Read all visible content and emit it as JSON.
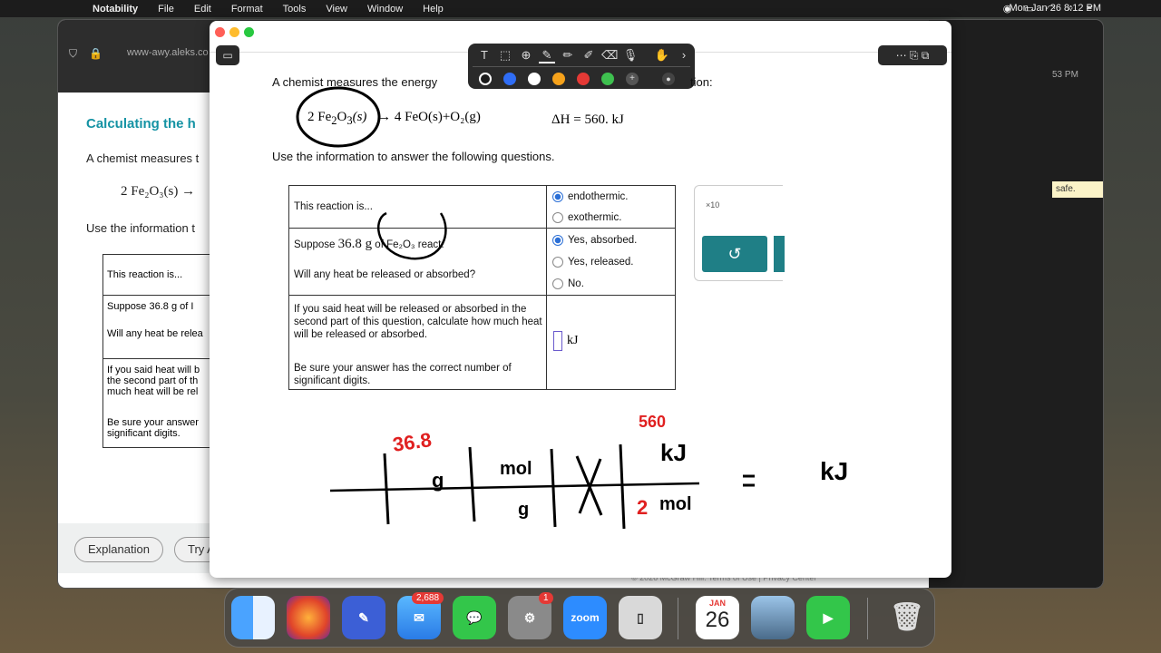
{
  "menubar": {
    "apple": "",
    "app": "Notability",
    "items": [
      "File",
      "Edit",
      "Format",
      "Tools",
      "View",
      "Window",
      "Help"
    ],
    "clock": "Mon Jan 26  8:12 PM"
  },
  "browser": {
    "url": "www-awy.aleks.co",
    "title": "Calculating the h",
    "intro": "A chemist measures t",
    "reaction": "2 Fe₂O₃(s) →",
    "use_info": "Use the information t",
    "rows": [
      "This reaction is...",
      "Suppose 36.8 g of I",
      "Will any heat be relea",
      "If you said heat will b",
      "the second part of th",
      "much heat will be rel",
      "Be sure your answer",
      "significant digits."
    ],
    "buttons": {
      "explanation": "Explanation",
      "try": "Try A"
    },
    "footer": "© 2026 McGraw Hill.   Terms of Use   |   Privacy Center",
    "side_time": "53 PM",
    "side_note": "safe."
  },
  "note": {
    "question": "A chemist measures the energy",
    "question_end": "tion:",
    "reaction_left": "2 Fe",
    "reaction_right": "→ 4 FeO(s)+O₂(g)",
    "reaction_sub": "2",
    "reaction_o": "O",
    "reaction_sub2": "3",
    "reaction_s": "(s)",
    "enthalpy": "ΔH = 560. kJ",
    "use_info": "Use the information to answer the following questions.",
    "table": {
      "r1_label": "This reaction is...",
      "r1_opt1": "endothermic.",
      "r1_opt2": "exothermic.",
      "r2_label_a": "Suppose ",
      "r2_mass": "36.8 g",
      "r2_label_b": " of Fe₂O₃ react.",
      "r2_label_c": "Will any heat be released or absorbed?",
      "r2_opt1": "Yes, absorbed.",
      "r2_opt2": "Yes, released.",
      "r2_opt3": "No.",
      "r3_text_a": "If you said heat will be released or absorbed in the second part of this question, calculate how much heat will be released or absorbed.",
      "r3_text_b": "Be sure your answer has the correct number of significant digits.",
      "unit": "kJ"
    },
    "widget_label": "×10",
    "undo": "↺",
    "handwriting": {
      "mass": "36.8",
      "g": "g",
      "mol": "mol",
      "g2": "g",
      "kJ": "kJ",
      "mol2": "mol",
      "two": "2",
      "560": "560",
      "eq": "=",
      "kJ_ans": "kJ",
      "x": "X"
    }
  },
  "toolbar_colors": [
    "#1b1b1b",
    "#2f6df5",
    "#ffffff",
    "#f6a21b",
    "#e53935",
    "#3ec04f"
  ],
  "dock": {
    "mail_badge": "2,688",
    "settings_badge": "1",
    "zoom": "zoom",
    "cal_month": "JAN",
    "cal_day": "26"
  }
}
